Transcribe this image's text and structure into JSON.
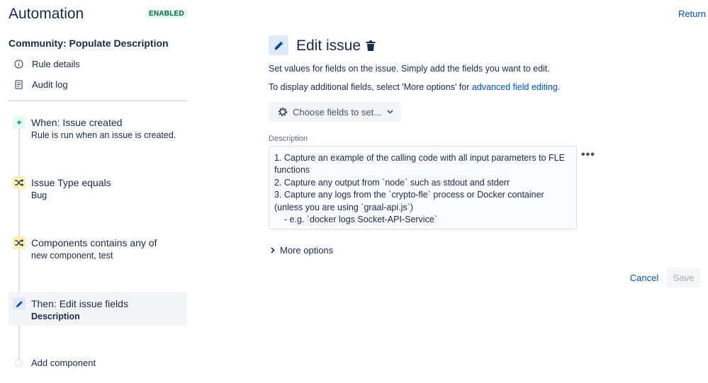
{
  "header": {
    "title": "Automation",
    "status": "ENABLED",
    "return_label": "Return"
  },
  "sidebar": {
    "rule_name": "Community: Populate Description",
    "links": [
      {
        "label": "Rule details",
        "icon": "info-icon"
      },
      {
        "label": "Audit log",
        "icon": "document-icon"
      }
    ],
    "steps": [
      {
        "title": "When: Issue created",
        "subtitle": "Rule is run when an issue is created.",
        "type": "trigger",
        "icon": "plus-icon"
      },
      {
        "title": "Issue Type equals",
        "subtitle": "Bug",
        "type": "condition",
        "icon": "shuffle-icon"
      },
      {
        "title": "Components contains any of",
        "subtitle": "new component, test",
        "type": "condition",
        "icon": "shuffle-icon"
      },
      {
        "title": "Then: Edit issue fields",
        "subtitle": "Description",
        "type": "action",
        "icon": "pencil-icon",
        "selected": true
      }
    ],
    "add_component_label": "Add component"
  },
  "panel": {
    "title": "Edit issue",
    "description_line1": "Set values for fields on the issue. Simply add the fields you want to edit.",
    "description_line2_prefix": "To display additional fields, select 'More options' for ",
    "description_line2_link": "advanced field editing",
    "description_line2_suffix": ".",
    "choose_fields_label": "Choose fields to set...",
    "field_label": "Description",
    "field_value": "1. Capture an example of the calling code with all input parameters to FLE functions\n2. Capture any output from `node` such as stdout and stderr\n3. Capture any logs from the `crypto-fle` process or Docker container (unless you are using `graal-api.js`)\n    - e.g. `docker logs Socket-API-Service`",
    "more_options_label": "More options",
    "cancel_label": "Cancel",
    "save_label": "Save"
  },
  "colors": {
    "accent": "#0052cc",
    "enabled_badge_bg": "#e3fcef",
    "enabled_badge_text": "#006644",
    "trigger_icon_bg": "#e3fcef",
    "condition_icon_bg": "#fff0b3",
    "action_icon_bg": "#deebff"
  }
}
